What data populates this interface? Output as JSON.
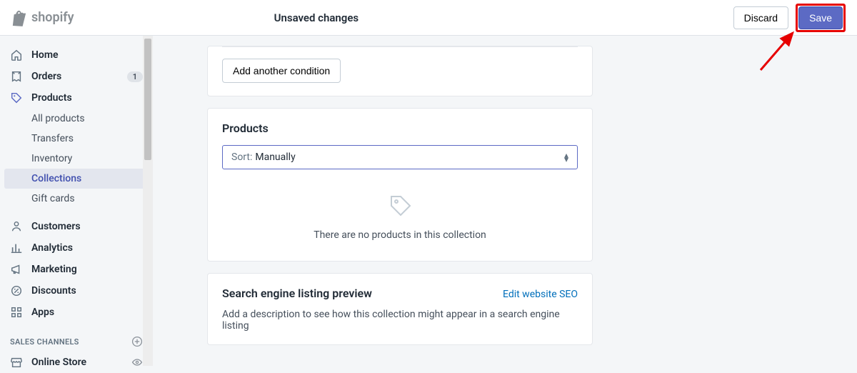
{
  "brand": "shopify",
  "topbar": {
    "title": "Unsaved changes",
    "discard": "Discard",
    "save": "Save"
  },
  "nav": {
    "home": "Home",
    "orders": "Orders",
    "orders_badge": "1",
    "products": "Products",
    "sub": {
      "all_products": "All products",
      "transfers": "Transfers",
      "inventory": "Inventory",
      "collections": "Collections",
      "gift_cards": "Gift cards"
    },
    "customers": "Customers",
    "analytics": "Analytics",
    "marketing": "Marketing",
    "discounts": "Discounts",
    "apps": "Apps",
    "sales_channels_header": "SALES CHANNELS",
    "online_store": "Online Store"
  },
  "conditions": {
    "add_button": "Add another condition"
  },
  "products_card": {
    "title": "Products",
    "sort_label": "Sort:",
    "sort_value": "Manually",
    "empty": "There are no products in this collection"
  },
  "seo_card": {
    "title": "Search engine listing preview",
    "link": "Edit website SEO",
    "desc": "Add a description to see how this collection might appear in a search engine listing"
  }
}
